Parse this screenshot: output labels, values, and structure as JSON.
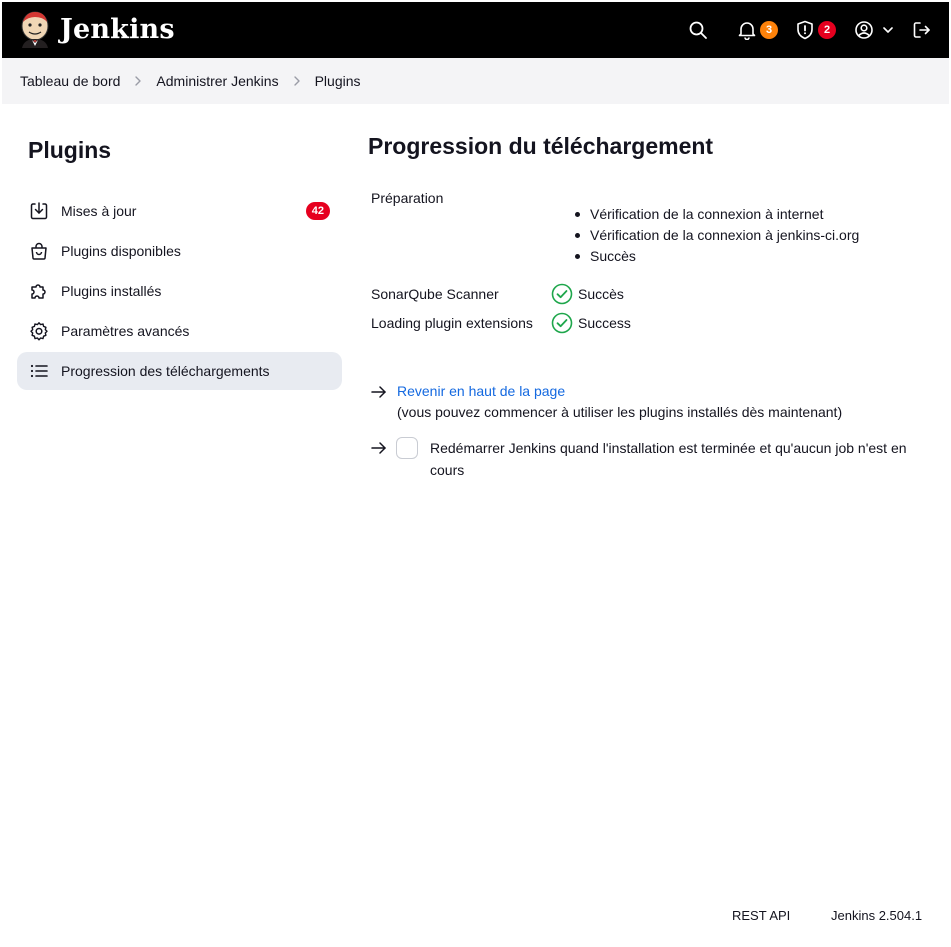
{
  "header": {
    "logo_text": "Jenkins",
    "notifications_count": "3",
    "security_count": "2",
    "notification_color": "#fe820a",
    "security_color": "#e6001f"
  },
  "breadcrumb": {
    "items": [
      "Tableau de bord",
      "Administrer Jenkins",
      "Plugins"
    ]
  },
  "sidebar": {
    "title": "Plugins",
    "items": [
      {
        "label": "Mises à jour",
        "icon": "download-icon",
        "badge": "42"
      },
      {
        "label": "Plugins disponibles",
        "icon": "shopping-bag-icon"
      },
      {
        "label": "Plugins installés",
        "icon": "puzzle-icon"
      },
      {
        "label": "Paramètres avancés",
        "icon": "gear-icon"
      },
      {
        "label": "Progression des téléchargements",
        "icon": "list-icon",
        "active": true
      }
    ]
  },
  "main": {
    "title": "Progression du téléchargement",
    "preparation": {
      "label": "Préparation",
      "steps": [
        "Vérification de la connexion à internet",
        "Vérification de la connexion à jenkins-ci.org",
        "Succès"
      ]
    },
    "statuses": [
      {
        "name": "SonarQube Scanner",
        "status": "Succès"
      },
      {
        "name": "Loading plugin extensions",
        "status": "Success"
      }
    ],
    "back_link": "Revenir en haut de la page",
    "back_note": "(vous pouvez commencer à utiliser les plugins installés dès maintenant)",
    "restart_line1": "Redémarrer Jenkins quand l'installation est terminée et qu'aucun job n'est en",
    "restart_line2": "cours",
    "success_color": "#1ea64b",
    "link_color": "#1469e0"
  },
  "footer": {
    "rest_api": "REST API",
    "version": "Jenkins 2.504.1"
  }
}
